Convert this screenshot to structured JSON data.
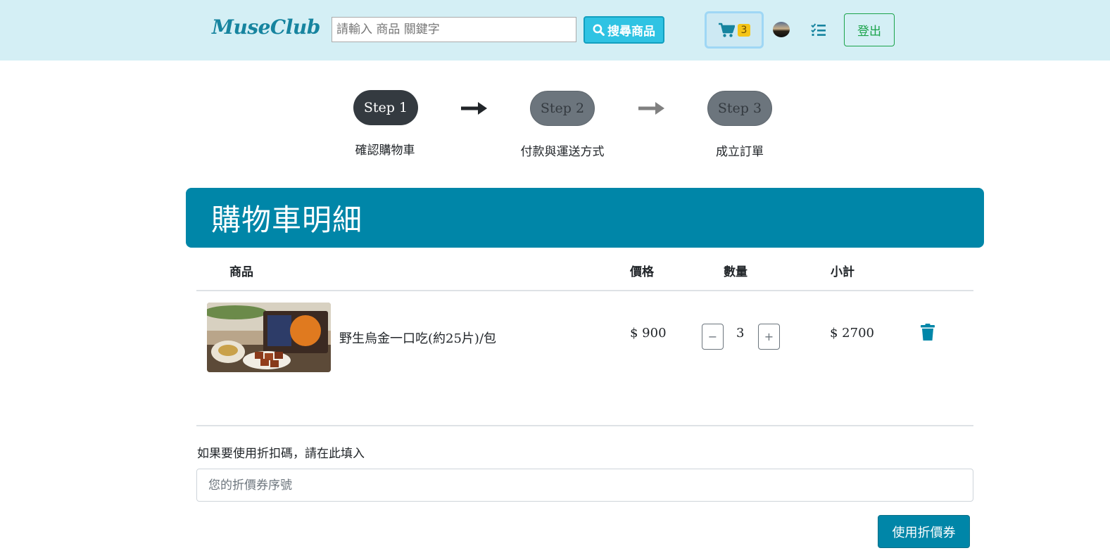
{
  "navbar": {
    "brand": "MuseClub",
    "search_placeholder": "請輸入 商品 關鍵字",
    "search_button": "搜尋商品",
    "cart_count": "3",
    "logout": "登出"
  },
  "steps": [
    {
      "label": "Step 1",
      "caption": "確認購物車",
      "active": true
    },
    {
      "label": "Step 2",
      "caption": "付款與運送方式",
      "active": false
    },
    {
      "label": "Step 3",
      "caption": "成立訂單",
      "active": false
    }
  ],
  "banner_title": "購物車明細",
  "table": {
    "headers": {
      "product": "商品",
      "price": "價格",
      "qty": "數量",
      "subtotal": "小計"
    },
    "rows": [
      {
        "name": "野生烏金一口吃(約25片)/包",
        "price": "$ 900",
        "qty": "3",
        "subtotal": "$ 2700",
        "minus": "−",
        "plus": "+"
      }
    ]
  },
  "coupon": {
    "label": "如果要使用折扣碼，請在此填入",
    "placeholder": "您的折價券序號",
    "button": "使用折價券"
  },
  "colors": {
    "accent": "#0086a8",
    "navbar": "#d4eff5",
    "logout": "#1aa34a",
    "badge": "#f5c518"
  }
}
